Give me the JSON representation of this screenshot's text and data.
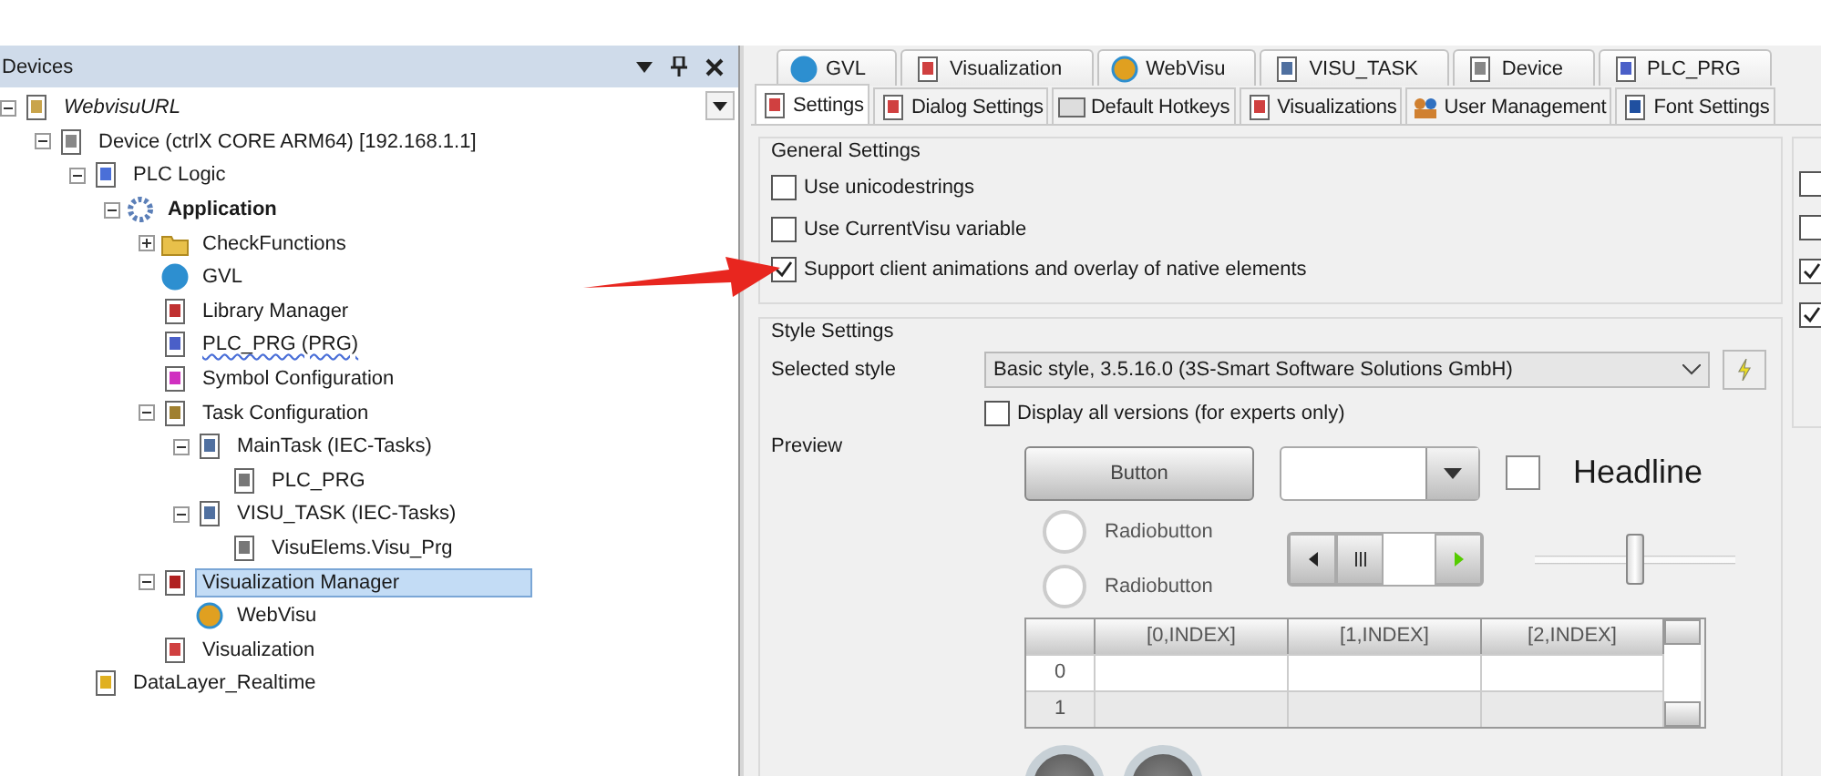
{
  "devices_panel": {
    "title": "Devices",
    "tree": [
      {
        "label": "WebvisuURL",
        "kind": "project",
        "active": false,
        "flagged": false,
        "expanded": true,
        "selected": false,
        "children": [
          {
            "label": "Device (ctrlX CORE ARM64) [192.168.1.1]",
            "kind": "device",
            "active": false,
            "flagged": false,
            "expanded": true,
            "selected": false,
            "children": [
              {
                "label": "PLC Logic",
                "kind": "plc",
                "active": false,
                "flagged": false,
                "expanded": true,
                "selected": false,
                "children": [
                  {
                    "label": "Application",
                    "kind": "application",
                    "active": true,
                    "flagged": false,
                    "expanded": true,
                    "selected": false,
                    "children": [
                      {
                        "label": "CheckFunctions",
                        "kind": "folder",
                        "active": false,
                        "flagged": false,
                        "expanded": false,
                        "selected": false
                      },
                      {
                        "label": "GVL",
                        "kind": "globals",
                        "active": false,
                        "flagged": false,
                        "selected": false
                      },
                      {
                        "label": "Library Manager",
                        "kind": "library",
                        "active": false,
                        "flagged": false,
                        "selected": false
                      },
                      {
                        "label": "PLC_PRG (PRG)",
                        "kind": "program",
                        "active": false,
                        "flagged": true,
                        "selected": false
                      },
                      {
                        "label": "Symbol Configuration",
                        "kind": "symbols",
                        "active": false,
                        "flagged": false,
                        "selected": false
                      },
                      {
                        "label": "Task Configuration",
                        "kind": "taskconfig",
                        "active": false,
                        "flagged": false,
                        "expanded": true,
                        "selected": false,
                        "children": [
                          {
                            "label": "MainTask (IEC-Tasks)",
                            "kind": "task",
                            "active": false,
                            "flagged": false,
                            "expanded": true,
                            "selected": false,
                            "children": [
                              {
                                "label": "PLC_PRG",
                                "kind": "call",
                                "active": false,
                                "flagged": false,
                                "selected": false
                              }
                            ]
                          },
                          {
                            "label": "VISU_TASK (IEC-Tasks)",
                            "kind": "task",
                            "active": false,
                            "flagged": false,
                            "expanded": true,
                            "selected": false,
                            "children": [
                              {
                                "label": "VisuElems.Visu_Prg",
                                "kind": "call",
                                "active": false,
                                "flagged": false,
                                "selected": false
                              }
                            ]
                          }
                        ]
                      },
                      {
                        "label": "Visualization Manager",
                        "kind": "visumanager",
                        "active": false,
                        "flagged": false,
                        "expanded": true,
                        "selected": true,
                        "children": [
                          {
                            "label": "WebVisu",
                            "kind": "webvisu",
                            "active": false,
                            "flagged": false,
                            "selected": false
                          }
                        ]
                      },
                      {
                        "label": "Visualization",
                        "kind": "visualization",
                        "active": false,
                        "flagged": false,
                        "selected": false
                      }
                    ]
                  }
                ]
              },
              {
                "label": "DataLayer_Realtime",
                "kind": "datalayer",
                "active": false,
                "flagged": false,
                "selected": false
              }
            ]
          }
        ]
      }
    ]
  },
  "editor_tabs": [
    {
      "label": "GVL",
      "kind": "globals"
    },
    {
      "label": "Visualization",
      "kind": "visualization"
    },
    {
      "label": "WebVisu",
      "kind": "webvisu"
    },
    {
      "label": "VISU_TASK",
      "kind": "task"
    },
    {
      "label": "Device",
      "kind": "device"
    },
    {
      "label": "PLC_PRG",
      "kind": "program"
    }
  ],
  "settings_tabs": [
    {
      "label": "Settings",
      "kind": "visualization",
      "selected": true
    },
    {
      "label": "Dialog Settings",
      "kind": "visualization",
      "selected": false
    },
    {
      "label": "Default Hotkeys",
      "kind": "keyboard",
      "selected": false
    },
    {
      "label": "Visualizations",
      "kind": "visualization",
      "selected": false
    },
    {
      "label": "User Management",
      "kind": "users",
      "selected": false
    },
    {
      "label": "Font Settings",
      "kind": "font",
      "selected": false
    }
  ],
  "general_settings": {
    "title": "General Settings",
    "options": [
      {
        "label": "Use unicodestrings",
        "checked": false
      },
      {
        "label": "Use CurrentVisu variable",
        "checked": false
      },
      {
        "label": "Support client animations and overlay of native elements",
        "checked": true
      }
    ]
  },
  "side_group": {
    "checkboxes": [
      {
        "checked": false
      },
      {
        "checked": false
      },
      {
        "checked": true
      },
      {
        "checked": true
      }
    ]
  },
  "style_settings": {
    "title": "Style Settings",
    "selected_style_label": "Selected style",
    "selected_style": "Basic style, 3.5.16.0 (3S-Smart Software Solutions GmbH)",
    "display_all_versions": {
      "label": "Display all versions (for experts only)",
      "checked": false
    },
    "preview_label": "Preview",
    "preview": {
      "button": "Button",
      "headline": "Headline",
      "headline_checked": false,
      "radios": [
        {
          "label": "Radiobutton",
          "selected": false
        },
        {
          "label": "Radiobutton",
          "selected": false
        }
      ],
      "slider": {
        "level": 0.5
      },
      "table": {
        "columns": [
          "[0,INDEX]",
          "[1,INDEX]",
          "[2,INDEX]"
        ],
        "rows": [
          "0",
          "1"
        ]
      }
    }
  }
}
